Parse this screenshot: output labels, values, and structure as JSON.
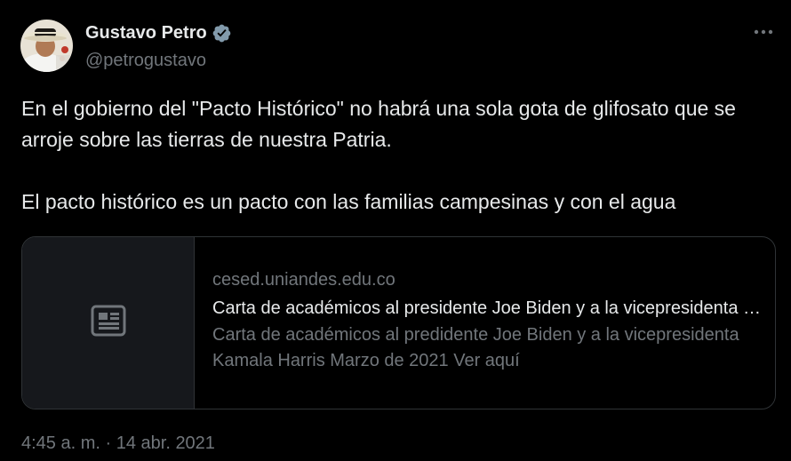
{
  "author": {
    "name": "Gustavo Petro",
    "handle": "@petrogustavo",
    "verified_icon": "verified-badge-icon"
  },
  "tweet": {
    "paragraph_1": "En el gobierno del \"Pacto Histórico\" no habrá una sola gota de glifosato que se arroje sobre las tierras de nuestra Patria.",
    "paragraph_2": "El pacto histórico es un pacto con las familias campesinas y con el agua"
  },
  "card": {
    "thumbnail_icon": "news-article-icon",
    "domain": "cesed.uniandes.edu.co",
    "title": "Carta de académicos al presidente Joe Biden y a la vicepresidenta Kamala Harris",
    "description": "Carta de académicos al predidente Joe Biden y a la vicepresidenta Kamala Harris Marzo de 2021 Ver aquí"
  },
  "meta": {
    "time": "4:45 a. m.",
    "separator": " · ",
    "date": "14 abr. 2021"
  },
  "colors": {
    "background": "#000000",
    "primary_text": "#e7e9ea",
    "secondary_text": "#71767b",
    "border": "#2f3336",
    "verified_badge": "#829aab"
  },
  "icons": {
    "more": "more-horizontal-icon"
  }
}
